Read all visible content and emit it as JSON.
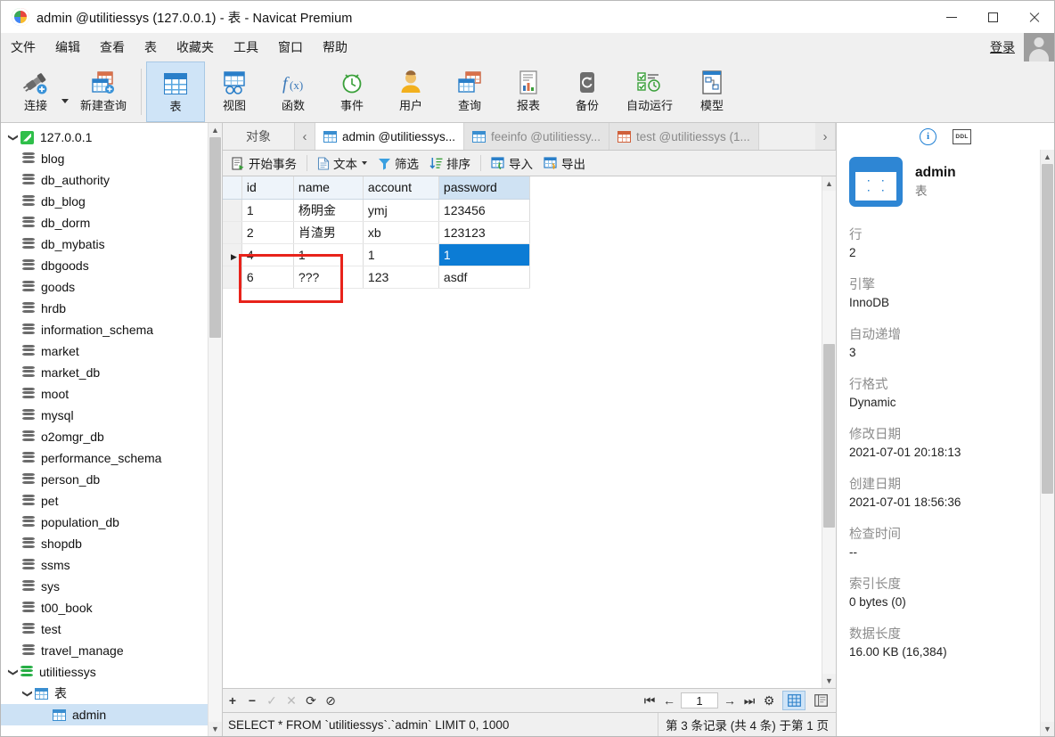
{
  "window": {
    "title": "admin @utilitiessys (127.0.0.1) - 表 - Navicat Premium",
    "app_icon": "navicat-logo-icon",
    "minimize": "—",
    "maximize": "□",
    "close": "✕"
  },
  "menubar": {
    "items": [
      {
        "label": "文件",
        "name": "menu-file"
      },
      {
        "label": "编辑",
        "name": "menu-edit"
      },
      {
        "label": "查看",
        "name": "menu-view"
      },
      {
        "label": "表",
        "name": "menu-table"
      },
      {
        "label": "收藏夹",
        "name": "menu-favorites"
      },
      {
        "label": "工具",
        "name": "menu-tools"
      },
      {
        "label": "窗口",
        "name": "menu-window"
      },
      {
        "label": "帮助",
        "name": "menu-help"
      }
    ],
    "login_label": "登录"
  },
  "toolbar": {
    "items": [
      {
        "label": "连接",
        "icon": "connection-plug-icon",
        "name": "toolbar-connection",
        "active": false
      },
      {
        "label": "新建查询",
        "icon": "new-query-icon",
        "name": "toolbar-new-query",
        "active": false
      },
      {
        "label": "表",
        "icon": "table-icon",
        "name": "toolbar-table",
        "active": true
      },
      {
        "label": "视图",
        "icon": "view-icon",
        "name": "toolbar-view",
        "active": false
      },
      {
        "label": "函数",
        "icon": "function-fx-icon",
        "name": "toolbar-function",
        "active": false
      },
      {
        "label": "事件",
        "icon": "event-clock-icon",
        "name": "toolbar-event",
        "active": false
      },
      {
        "label": "用户",
        "icon": "user-icon",
        "name": "toolbar-user",
        "active": false
      },
      {
        "label": "查询",
        "icon": "query-icon",
        "name": "toolbar-query",
        "active": false
      },
      {
        "label": "报表",
        "icon": "report-icon",
        "name": "toolbar-report",
        "active": false
      },
      {
        "label": "备份",
        "icon": "backup-icon",
        "name": "toolbar-backup",
        "active": false
      },
      {
        "label": "自动运行",
        "icon": "automation-icon",
        "name": "toolbar-automation",
        "active": false
      },
      {
        "label": "模型",
        "icon": "model-icon",
        "name": "toolbar-model",
        "active": false
      }
    ]
  },
  "tree": {
    "connection": {
      "label": "127.0.0.1",
      "icon": "mysql-server-icon",
      "expanded": true
    },
    "databases": [
      {
        "label": "blog"
      },
      {
        "label": "db_authority"
      },
      {
        "label": "db_blog"
      },
      {
        "label": "db_dorm"
      },
      {
        "label": "db_mybatis"
      },
      {
        "label": "dbgoods"
      },
      {
        "label": "goods"
      },
      {
        "label": "hrdb"
      },
      {
        "label": "information_schema"
      },
      {
        "label": "market"
      },
      {
        "label": "market_db"
      },
      {
        "label": "moot"
      },
      {
        "label": "mysql"
      },
      {
        "label": "o2omgr_db"
      },
      {
        "label": "performance_schema"
      },
      {
        "label": "person_db"
      },
      {
        "label": "pet"
      },
      {
        "label": "population_db"
      },
      {
        "label": "shopdb"
      },
      {
        "label": "ssms"
      },
      {
        "label": "sys"
      },
      {
        "label": "t00_book"
      },
      {
        "label": "test"
      },
      {
        "label": "travel_manage"
      }
    ],
    "active_db": {
      "label": "utilitiessys",
      "expanded": true
    },
    "tables_folder": {
      "label": "表",
      "expanded": true
    },
    "selected_table": {
      "label": "admin"
    }
  },
  "tabs": {
    "object_button": "对象",
    "prev_arrow": "‹",
    "next_arrow": "›",
    "items": [
      {
        "label": "admin @utilitiessys...",
        "active": true,
        "icon": "table-icon"
      },
      {
        "label": "feeinfo @utilitiessy...",
        "active": false,
        "icon": "table-icon"
      },
      {
        "label": "test @utilitiessys (1...",
        "active": false,
        "icon": "table-orange-icon"
      }
    ]
  },
  "grid_toolbar": {
    "begin_transaction": "开始事务",
    "text": "文本",
    "filter": "筛选",
    "sort": "排序",
    "import": "导入",
    "export": "导出"
  },
  "grid": {
    "columns": [
      "id",
      "name",
      "account",
      "password"
    ],
    "selected_column": "password",
    "rows": [
      {
        "id": "1",
        "name": "杨明金",
        "account": "ymj",
        "password": "123456",
        "current": false
      },
      {
        "id": "2",
        "name": "肖渣男",
        "account": "xb",
        "password": "123123",
        "current": false
      },
      {
        "id": "4",
        "name": "1",
        "account": "1",
        "password": "1",
        "current": true
      },
      {
        "id": "6",
        "name": "???",
        "account": "123",
        "password": "asdf",
        "current": false
      }
    ],
    "selected_cell": {
      "row": 2,
      "column": "password"
    },
    "annotation": {
      "type": "red-rectangle",
      "color": "#e8231b"
    }
  },
  "grid_nav": {
    "add": "+",
    "remove": "−",
    "confirm": "✓",
    "cancel": "✕",
    "refresh": "⟳",
    "stop": "⊘",
    "first": "⏮",
    "prev": "←",
    "page": "1",
    "next": "→",
    "last": "⏭",
    "settings": "⚙",
    "grid_view": "grid-view-icon",
    "form_view": "form-view-icon"
  },
  "status": {
    "sql": "SELECT * FROM `utilitiessys`.`admin` LIMIT 0, 1000",
    "record_info": "第 3 条记录 (共 4 条) 于第 1 页"
  },
  "info_panel": {
    "tab_info_icon": "info-circle-icon",
    "tab_ddl_icon": "ddl-icon",
    "object_name": "admin",
    "object_type": "表",
    "fields": [
      {
        "label": "行",
        "value": "2"
      },
      {
        "label": "引擎",
        "value": "InnoDB"
      },
      {
        "label": "自动递增",
        "value": "3"
      },
      {
        "label": "行格式",
        "value": "Dynamic"
      },
      {
        "label": "修改日期",
        "value": "2021-07-01 20:18:13"
      },
      {
        "label": "创建日期",
        "value": "2021-07-01 18:56:36"
      },
      {
        "label": "检查时间",
        "value": "--"
      },
      {
        "label": "索引长度",
        "value": "0 bytes (0)"
      },
      {
        "label": "数据长度",
        "value": "16.00 KB (16,384)"
      }
    ]
  }
}
